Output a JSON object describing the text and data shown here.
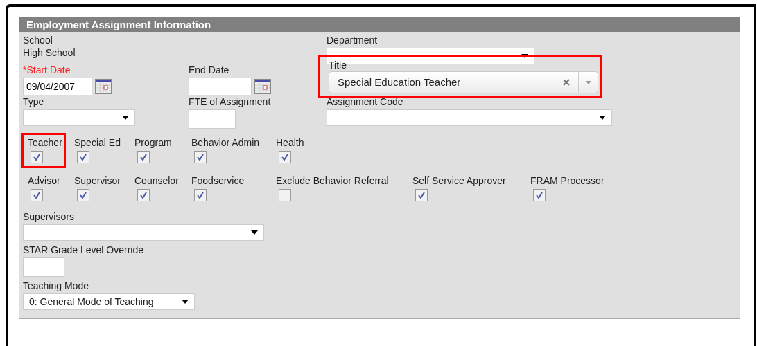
{
  "section": {
    "title": "Employment Assignment Information"
  },
  "rows": [
    {
      "left": {
        "kind": "static",
        "label": "School",
        "value": "High School"
      },
      "right": {
        "kind": "select",
        "label": "Department"
      }
    },
    {
      "left": {
        "kind": "date",
        "label": "*Start Date",
        "required": true,
        "value": "09/04/2007"
      },
      "middle": {
        "kind": "date",
        "label": "End Date",
        "required": false
      },
      "right": {
        "kind": "combo",
        "label": "Title",
        "value": "Special Education Teacher",
        "highlighted": true
      }
    },
    {
      "left": {
        "kind": "select",
        "label": "Type"
      },
      "middle": {
        "kind": "input",
        "label": "FTE of Assignment"
      },
      "right": {
        "kind": "select",
        "label": "Assignment Code"
      }
    }
  ],
  "roles": [
    [
      {
        "label": "Teacher",
        "checked": true,
        "highlighted": true
      },
      {
        "label": "Special Ed",
        "checked": true,
        "highlighted": false
      },
      {
        "label": "Program",
        "checked": true,
        "highlighted": false
      },
      {
        "label": "Behavior Admin",
        "checked": true,
        "highlighted": false
      },
      {
        "label": "Health",
        "checked": true,
        "highlighted": false
      }
    ],
    [
      {
        "label": "Advisor",
        "checked": true,
        "highlighted": false
      },
      {
        "label": "Supervisor",
        "checked": true,
        "highlighted": false
      },
      {
        "label": "Counselor",
        "checked": true,
        "highlighted": false
      },
      {
        "label": "Foodservice",
        "checked": true,
        "highlighted": false
      },
      {
        "label": "Exclude Behavior Referral",
        "checked": false,
        "highlighted": false
      },
      {
        "label": "Self Service Approver",
        "checked": true,
        "highlighted": false
      },
      {
        "label": "FRAM Processor",
        "checked": true,
        "highlighted": false
      }
    ]
  ],
  "lower_fields": [
    {
      "kind": "select",
      "label": "Supervisors"
    },
    {
      "kind": "input",
      "label": "STAR Grade Level Override"
    },
    {
      "kind": "select",
      "label": "Teaching Mode",
      "value": "0: General Mode of Teaching"
    }
  ]
}
